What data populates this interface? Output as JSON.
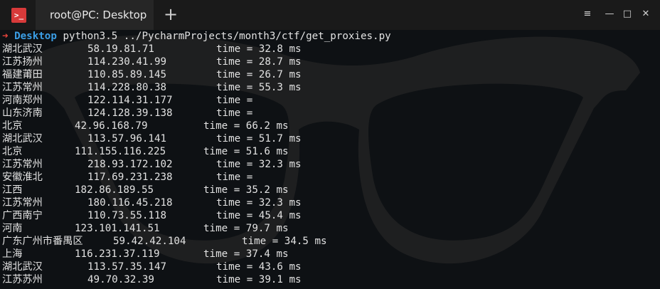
{
  "window": {
    "app_icon_text": ">_",
    "tab_title": "root@PC: Desktop",
    "new_tab_label": "+",
    "menu_label": "≡",
    "minimize_label": "—",
    "maximize_label": "□",
    "close_label": "✕"
  },
  "terminal": {
    "prompt_arrow": "➜",
    "cwd": "Desktop",
    "command": "python3.5 ../PycharmProjects/month3/ctf/get_proxies.py",
    "rows": [
      {
        "loc": "湖北武汉",
        "ip": "58.19.81.71",
        "time": "time = 32.8 ms"
      },
      {
        "loc": "江苏扬州",
        "ip": "114.230.41.99",
        "time": "time = 28.7 ms"
      },
      {
        "loc": "福建莆田",
        "ip": "110.85.89.145",
        "time": "time = 26.7 ms"
      },
      {
        "loc": "江苏常州",
        "ip": "114.228.80.38",
        "time": "time = 55.3 ms"
      },
      {
        "loc": "河南郑州",
        "ip": "122.114.31.177",
        "time": "time ="
      },
      {
        "loc": "山东济南",
        "ip": "124.128.39.138",
        "time": "time ="
      },
      {
        "loc": "北京",
        "ip": "42.96.168.79",
        "time": "time = 66.2 ms"
      },
      {
        "loc": "湖北武汉",
        "ip": "113.57.96.141",
        "time": "time = 51.7 ms"
      },
      {
        "loc": "北京",
        "ip": "111.155.116.225",
        "time": "time = 51.6 ms"
      },
      {
        "loc": "江苏常州",
        "ip": "218.93.172.102",
        "time": "time = 32.3 ms"
      },
      {
        "loc": "安徽淮北",
        "ip": "117.69.231.238",
        "time": "time ="
      },
      {
        "loc": "江西",
        "ip": "182.86.189.55",
        "time": "time = 35.2 ms"
      },
      {
        "loc": "江苏常州",
        "ip": "180.116.45.218",
        "time": "time = 32.3 ms"
      },
      {
        "loc": "广西南宁",
        "ip": "110.73.55.118",
        "time": "time = 45.4 ms"
      },
      {
        "loc": "河南",
        "ip": "123.101.141.51",
        "time": "time = 79.7 ms"
      },
      {
        "loc": "广东广州市番禺区",
        "ip": "59.42.42.104",
        "time": "time = 34.5 ms"
      },
      {
        "loc": "上海",
        "ip": "116.231.37.119",
        "time": "time = 37.4 ms"
      },
      {
        "loc": "湖北武汉",
        "ip": "113.57.35.147",
        "time": "time = 43.6 ms"
      },
      {
        "loc": "江苏苏州",
        "ip": "49.70.32.39",
        "time": "time = 39.1 ms"
      }
    ]
  },
  "colors": {
    "background": "#0e1114",
    "titlebar": "#1a1a1a",
    "tab": "#262626",
    "text": "#e2e2e2",
    "prompt_arrow": "#e8443c",
    "cwd": "#3b9ee6",
    "app_icon": "#d83a3a"
  }
}
